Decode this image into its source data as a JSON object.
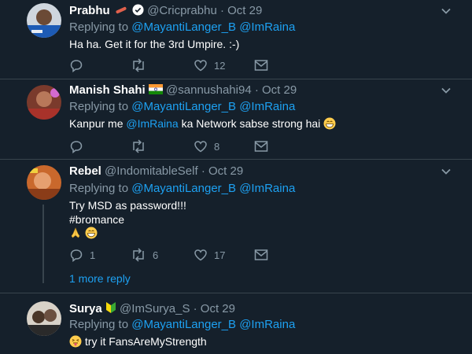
{
  "tweets": [
    {
      "name": "Prabhu",
      "handle": "@Cricprabhu",
      "date": "· Oct 29",
      "replying_label": "Replying to",
      "mention1": "@MayantiLanger_B",
      "mention2": "@ImRaina",
      "text": "Ha ha. Get it for the 3rd Umpire. :-)",
      "retweets": "",
      "likes": "12"
    },
    {
      "name": "Manish Shahi",
      "handle": "@sannushahi94",
      "date": "· Oct 29",
      "replying_label": "Replying to",
      "mention1": "@MayantiLanger_B",
      "mention2": "@ImRaina",
      "text_pre": "Kanpur me ",
      "text_mention": "@ImRaina",
      "text_post": " ka Network sabse strong hai",
      "likes": "8"
    },
    {
      "name": "Rebel",
      "handle": "@IndomitableSelf",
      "date": "· Oct 29",
      "replying_label": "Replying to",
      "mention1": "@MayantiLanger_B",
      "mention2": "@ImRaina",
      "text": "Try MSD as password!!!",
      "hashtag": "#bromance",
      "replies": "1",
      "retweets": "6",
      "likes": "17",
      "more_replies": "1 more reply"
    },
    {
      "name": "Surya",
      "handle": "@ImSurya_S",
      "date": "· Oct 29",
      "replying_label": "Replying to",
      "mention1": "@MayantiLanger_B",
      "mention2": "@ImRaina",
      "text": "try it FansAreMyStrength"
    }
  ],
  "colors": {
    "background": "#15202b",
    "divider": "#38444d",
    "muted": "#8899a6",
    "link": "#1da1f2"
  },
  "icons": [
    "chevron-down-icon",
    "reply-icon",
    "retweet-icon",
    "like-icon",
    "share-icon",
    "verified-icon",
    "india-flag-icon",
    "bat-icon",
    "grinning-emoji",
    "folded-hands-emoji",
    "tongue-emoji",
    "beginner-icon"
  ]
}
